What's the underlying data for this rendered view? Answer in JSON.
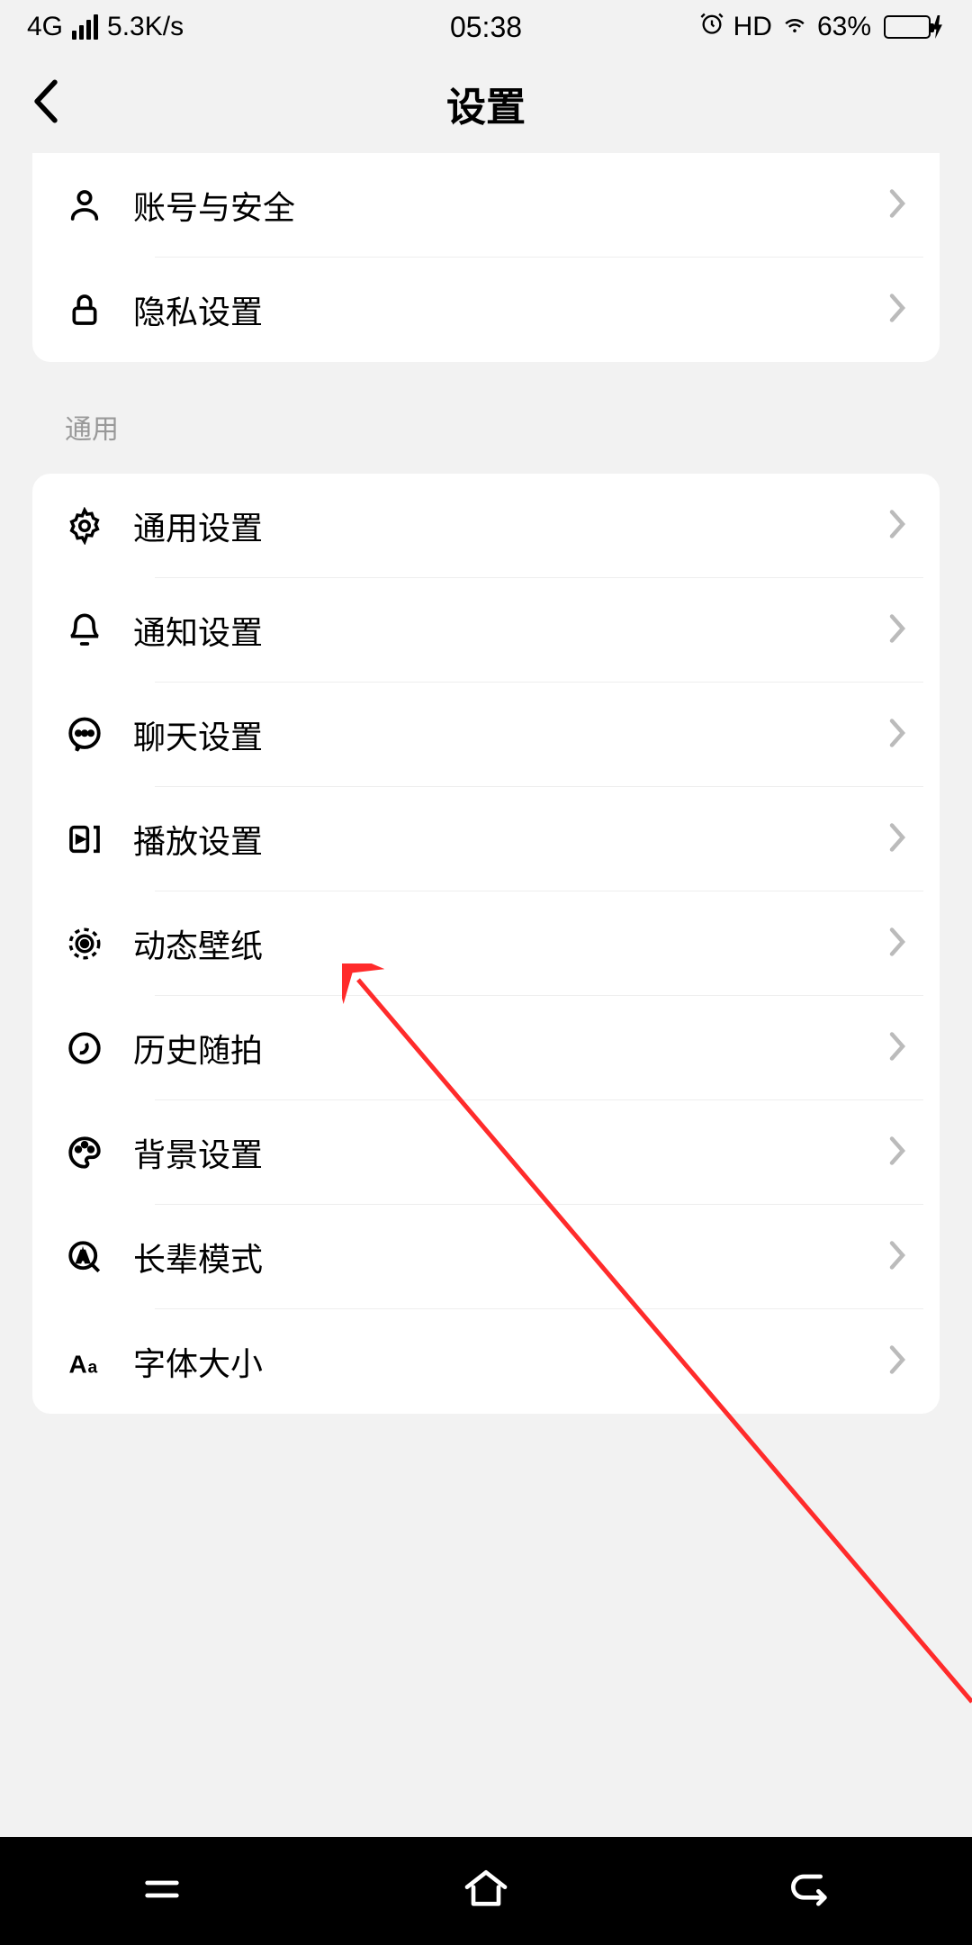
{
  "status": {
    "network": "4G",
    "speed": "5.3K/s",
    "time": "05:38",
    "hd": "HD",
    "battery_pct": "63%"
  },
  "header": {
    "title": "设置"
  },
  "group1": {
    "items": [
      {
        "label": "账号与安全",
        "icon": "user-icon"
      },
      {
        "label": "隐私设置",
        "icon": "lock-icon"
      }
    ]
  },
  "section_general_label": "通用",
  "group2": {
    "items": [
      {
        "label": "通用设置",
        "icon": "gear-icon"
      },
      {
        "label": "通知设置",
        "icon": "bell-icon"
      },
      {
        "label": "聊天设置",
        "icon": "chat-icon"
      },
      {
        "label": "播放设置",
        "icon": "play-icon"
      },
      {
        "label": "动态壁纸",
        "icon": "wallpaper-icon"
      },
      {
        "label": "历史随拍",
        "icon": "history-icon"
      },
      {
        "label": "背景设置",
        "icon": "palette-icon"
      },
      {
        "label": "长辈模式",
        "icon": "elder-icon"
      },
      {
        "label": "字体大小",
        "icon": "font-icon"
      }
    ]
  }
}
